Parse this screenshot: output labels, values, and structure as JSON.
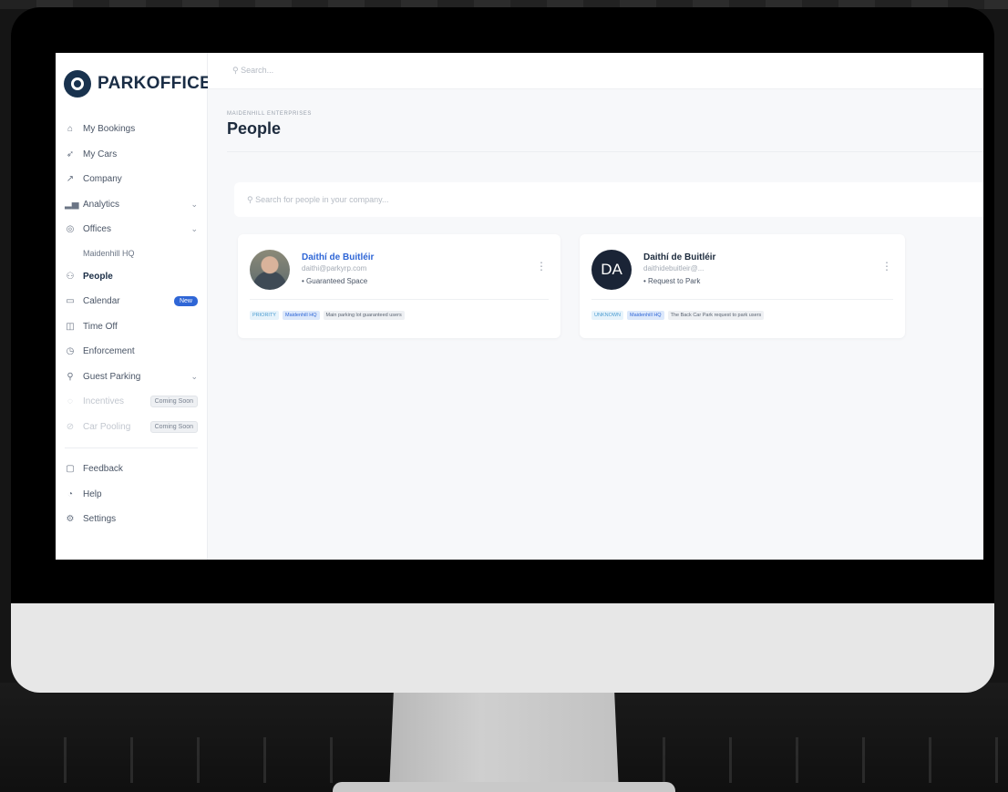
{
  "brand": {
    "name": "PARKOFFICE"
  },
  "topbar": {
    "search_placeholder": "Search..."
  },
  "sidebar": {
    "items": [
      {
        "label": "My Bookings",
        "icon": "home-icon",
        "glyph": "⌂"
      },
      {
        "label": "My Cars",
        "icon": "send-icon",
        "glyph": "➶"
      },
      {
        "label": "Company",
        "icon": "trend-icon",
        "glyph": "↗"
      },
      {
        "label": "Analytics",
        "icon": "bar-chart-icon",
        "glyph": "▂▅",
        "chevron": "⌄"
      },
      {
        "label": "Offices",
        "icon": "location-pin-icon",
        "glyph": "◎",
        "chevron": "⌄"
      },
      {
        "label": "Maidenhill HQ"
      },
      {
        "label": "People",
        "icon": "people-icon",
        "glyph": "⚇"
      },
      {
        "label": "Calendar",
        "icon": "calendar-icon",
        "glyph": "▭",
        "badge": "New"
      },
      {
        "label": "Time Off",
        "icon": "briefcase-icon",
        "glyph": "◫"
      },
      {
        "label": "Enforcement",
        "icon": "clock-icon",
        "glyph": "◷"
      },
      {
        "label": "Guest Parking",
        "icon": "guest-icon",
        "glyph": "⚲",
        "chevron": "⌄"
      },
      {
        "label": "Incentives",
        "icon": "incentives-icon",
        "glyph": "◌",
        "badge": "Coming Soon"
      },
      {
        "label": "Car Pooling",
        "icon": "car-pool-icon",
        "glyph": "⊘",
        "badge": "Coming Soon"
      },
      {
        "label": "Feedback",
        "icon": "feedback-icon",
        "glyph": "▢"
      },
      {
        "label": "Help",
        "icon": "help-icon",
        "glyph": "◔"
      },
      {
        "label": "Settings",
        "icon": "settings-icon",
        "glyph": "⚙"
      }
    ]
  },
  "page": {
    "breadcrumb": "MAIDENHILL ENTERPRISES",
    "title": "People",
    "people_search_placeholder": "Search for people in your company..."
  },
  "people": [
    {
      "name": "Daithí de Buitléir",
      "email": "daithi@parkyrp.com",
      "status": "• Guaranteed Space",
      "tags": [
        "PRIORITY",
        "Maidenhill HQ",
        "Main parking lot guaranteed users"
      ]
    },
    {
      "name": "Daithí de Buitléir",
      "initials": "DA",
      "email": "daithidebuitleir@...",
      "status": "• Request to Park",
      "tags": [
        "UNKNOWN",
        "Maidenhill HQ",
        "The Back Car Park request to park users"
      ]
    }
  ],
  "colors": {
    "accent": "#2f66d6",
    "brand": "#19324e"
  }
}
